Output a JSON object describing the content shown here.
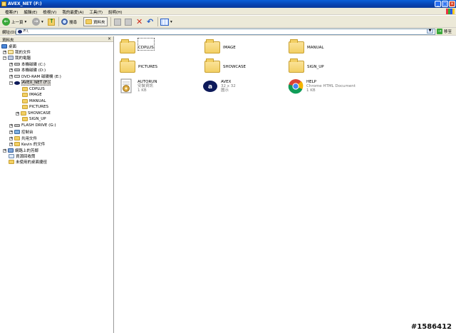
{
  "window": {
    "title": "AVEX_NET (F:)"
  },
  "menu": [
    "檔案(F)",
    "編輯(E)",
    "檢視(V)",
    "我的最愛(A)",
    "工具(T)",
    "說明(H)"
  ],
  "toolbar": {
    "back_label": "上一頁",
    "search_label": "搜尋",
    "folders_label": "資料夾"
  },
  "address": {
    "label": "網址(D)",
    "value": "F:\\",
    "go_label": "移至"
  },
  "left_pane": {
    "title": "資料夾",
    "tree": [
      {
        "label": "桌面"
      },
      {
        "label": "我的文件"
      },
      {
        "label": "我的電腦"
      },
      {
        "label": "本機磁碟 (C:)"
      },
      {
        "label": "本機磁碟 (D:)"
      },
      {
        "label": "DVD-RAM 磁碟機 (E:)"
      },
      {
        "label": "AVEX_NET (F:)"
      },
      {
        "label": "CDPLUS"
      },
      {
        "label": "IMAGE"
      },
      {
        "label": "MANUAL"
      },
      {
        "label": "PICTURES"
      },
      {
        "label": "SHOWCASE"
      },
      {
        "label": "SIGN_UP"
      },
      {
        "label": "FLASH DRIVE (G:)"
      },
      {
        "label": "控制台"
      },
      {
        "label": "共用文件"
      },
      {
        "label": "Kevin 的文件"
      },
      {
        "label": "網路上的芳鄰"
      },
      {
        "label": "資源回收筒"
      },
      {
        "label": "未使用的桌面捷徑"
      }
    ]
  },
  "content": {
    "items": [
      {
        "name": "CDPLUS",
        "type": "folder"
      },
      {
        "name": "IMAGE",
        "type": "folder"
      },
      {
        "name": "MANUAL",
        "type": "folder"
      },
      {
        "name": "PICTURES",
        "type": "folder"
      },
      {
        "name": "SHOWCASE",
        "type": "folder"
      },
      {
        "name": "SIGN_UP",
        "type": "folder"
      },
      {
        "name": "AUTORUN",
        "line2": "安裝資訊",
        "line3": "1 KB",
        "type": "file"
      },
      {
        "name": "AVEX",
        "line2": "32 x 32",
        "line3": "圖示",
        "type": "file"
      },
      {
        "name": "HELP",
        "line2": "Chrome HTML Document",
        "line3": "1 KB",
        "type": "file"
      }
    ]
  },
  "watermark": "#1586412"
}
